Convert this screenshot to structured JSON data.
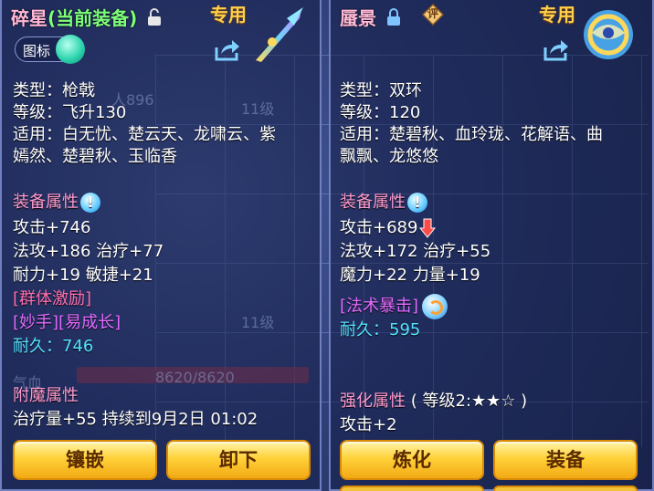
{
  "left": {
    "name": "碎星",
    "status": "(当前装备)",
    "exclusive": "专用",
    "icon_toggle_label": "图标",
    "lines": {
      "type": "类型：枪戟",
      "level": "等级：飞升130",
      "suits_1": "适用：白无忧、楚云天、龙啸云、紫",
      "suits_2": "嫣然、楚碧秋、玉临香"
    },
    "attr_header": "装备属性",
    "stats": [
      "攻击+746",
      "法攻+186 治疗+77",
      "耐力+19 敏捷+21"
    ],
    "special_1": "[群体激励]",
    "special_2": "[妙手][易成长]",
    "durability_label": "耐久：",
    "durability_value": "746",
    "enchant_header": "附魔属性",
    "enchant_line": "治疗量+55 持续到9月2日 01:02",
    "buttons": [
      "镶嵌",
      "卸下"
    ],
    "bg_hp_label": "气血",
    "bg_hp_value": "8620/8620",
    "bg_level_label": "11级"
  },
  "right": {
    "name": "蜃景",
    "eval_badge": "评",
    "exclusive": "专用",
    "lines": {
      "type": "类型：双环",
      "level": "等级：120",
      "suits_1": "适用：楚碧秋、血玲珑、花解语、曲",
      "suits_2": "飘飘、龙悠悠"
    },
    "attr_header": "装备属性",
    "stats": [
      "攻击+689",
      "法攻+172 治疗+55",
      "魔力+22 力量+19"
    ],
    "special_1": "[法术暴击]",
    "durability_label": "耐久：",
    "durability_value": "595",
    "strengthen_header": "强化属性",
    "strengthen_level": "( 等级2:★★☆ )",
    "strengthen_line": "攻击+2",
    "buttons": [
      "炼化",
      "装备"
    ]
  },
  "colors": {
    "title_pink": "#ffb7d5",
    "status_green": "#7dff7a",
    "header_pink": "#ff9bd0",
    "durability_cyan": "#55e2ff",
    "button_gold": "#ffd23a"
  }
}
